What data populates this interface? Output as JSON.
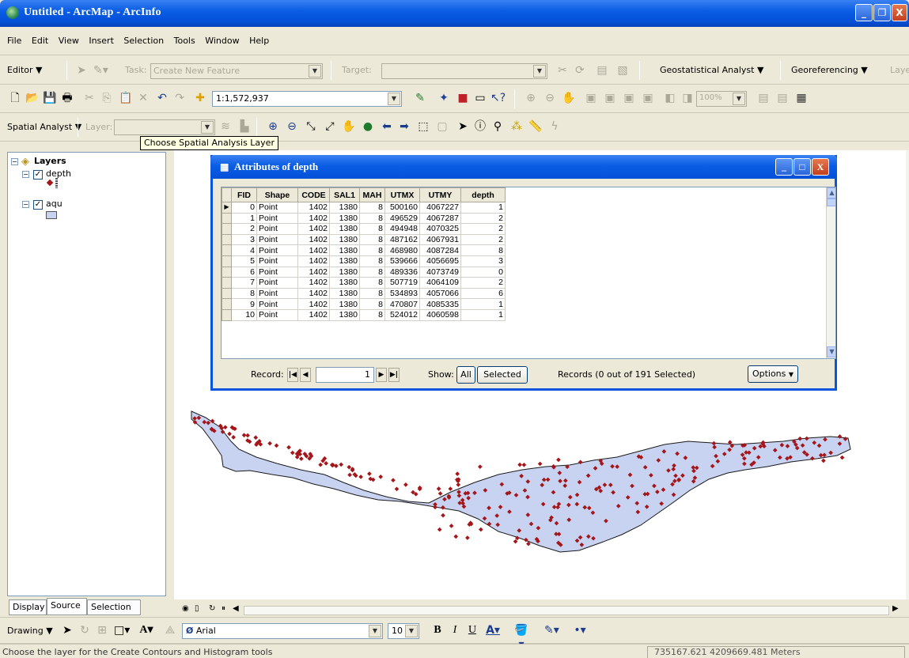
{
  "window": {
    "title": "Untitled - ArcMap - ArcInfo",
    "buttons": [
      "_",
      "❐",
      "X"
    ]
  },
  "menu": [
    "File",
    "Edit",
    "View",
    "Insert",
    "Selection",
    "Tools",
    "Window",
    "Help"
  ],
  "editor_toolbar": {
    "editor_label": "Editor ▼",
    "task_label": "Task:",
    "task_value": "Create New Feature",
    "target_label": "Target:",
    "geostat_label": "Geostatistical Analyst ▼",
    "georef_label": "Georeferencing ▼",
    "layer_cut": "Laye"
  },
  "standard_toolbar": {
    "scale": "1:1,572,937",
    "zoom_pct": "100%"
  },
  "spatial_toolbar": {
    "spatial_label": "Spatial Analyst ▼",
    "layer_label": "Layer:",
    "layer_value": ""
  },
  "tooltip": "Choose Spatial Analysis Layer",
  "toc": {
    "root": "Layers",
    "layers": [
      {
        "name": "depth",
        "symbol": "red-point"
      },
      {
        "name": "aqu",
        "symbol": "blue-polygon"
      }
    ],
    "tabs": [
      "Display",
      "Source",
      "Selection"
    ]
  },
  "attributes": {
    "title": "Attributes of depth",
    "columns": [
      "FID",
      "Shape",
      "CODE",
      "SAL1",
      "MAH",
      "UTMX",
      "UTMY",
      "depth"
    ],
    "rows": [
      [
        "0",
        "Point",
        "1402",
        "1380",
        "8",
        "500160",
        "4067227",
        "1"
      ],
      [
        "1",
        "Point",
        "1402",
        "1380",
        "8",
        "496529",
        "4067287",
        "2"
      ],
      [
        "2",
        "Point",
        "1402",
        "1380",
        "8",
        "494948",
        "4070325",
        "2"
      ],
      [
        "3",
        "Point",
        "1402",
        "1380",
        "8",
        "487162",
        "4067931",
        "2"
      ],
      [
        "4",
        "Point",
        "1402",
        "1380",
        "8",
        "468980",
        "4087284",
        "8"
      ],
      [
        "5",
        "Point",
        "1402",
        "1380",
        "8",
        "539666",
        "4056695",
        "3"
      ],
      [
        "6",
        "Point",
        "1402",
        "1380",
        "8",
        "489336",
        "4073749",
        "0"
      ],
      [
        "7",
        "Point",
        "1402",
        "1380",
        "8",
        "507719",
        "4064109",
        "2"
      ],
      [
        "8",
        "Point",
        "1402",
        "1380",
        "8",
        "534893",
        "4057066",
        "6"
      ],
      [
        "9",
        "Point",
        "1402",
        "1380",
        "8",
        "470807",
        "4085335",
        "1"
      ],
      [
        "10",
        "Point",
        "1402",
        "1380",
        "8",
        "524012",
        "4060598",
        "1"
      ]
    ],
    "record_label": "Record:",
    "record_value": "1",
    "show_label": "Show:",
    "all_label": "All",
    "selected_label": "Selected",
    "records_status": "Records (0 out of 191 Selected)",
    "options_label": "Options"
  },
  "drawing_toolbar": {
    "drawing_label": "Drawing ▼",
    "font": "Arial",
    "size": "10"
  },
  "status": {
    "message": "Choose the layer for the Create Contours and Histogram tools",
    "coordinates": "735167.621  4209669.481 Meters"
  },
  "colors": {
    "point": "#a4161a",
    "polygon_fill": "#c8d3f1",
    "polygon_stroke": "#1a1a1a",
    "titlebar": "#0a5de4"
  }
}
